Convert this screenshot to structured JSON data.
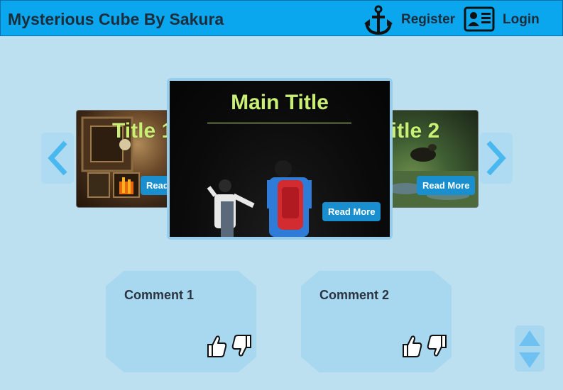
{
  "header": {
    "site_title": "Mysterious Cube By Sakura",
    "register_label": "Register",
    "login_label": "Login",
    "register_icon": "anchor-icon",
    "login_icon": "id-card-icon"
  },
  "carousel": {
    "prev_icon": "chevron-left-icon",
    "next_icon": "chevron-right-icon",
    "slides": [
      {
        "title": "Title 1",
        "button": "Read More",
        "position": "left"
      },
      {
        "title": "Main Title",
        "button": "Read More",
        "position": "center"
      },
      {
        "title": "Title 2",
        "button": "Read More",
        "position": "right"
      }
    ]
  },
  "comments": [
    {
      "title": "Comment 1",
      "like_icon": "thumbs-up-icon",
      "dislike_icon": "thumbs-down-icon"
    },
    {
      "title": "Comment 2",
      "like_icon": "thumbs-up-icon",
      "dislike_icon": "thumbs-down-icon"
    }
  ],
  "scroll": {
    "up_icon": "triangle-up-icon",
    "down_icon": "triangle-down-icon"
  },
  "colors": {
    "header": "#0aa6ee",
    "background": "#bde0f0",
    "title_text": "#1e2d3b",
    "slide_title": "#c9f075",
    "button": "#1a8fd0",
    "card": "#a8d7f0",
    "arrow": "#49b8ef"
  }
}
